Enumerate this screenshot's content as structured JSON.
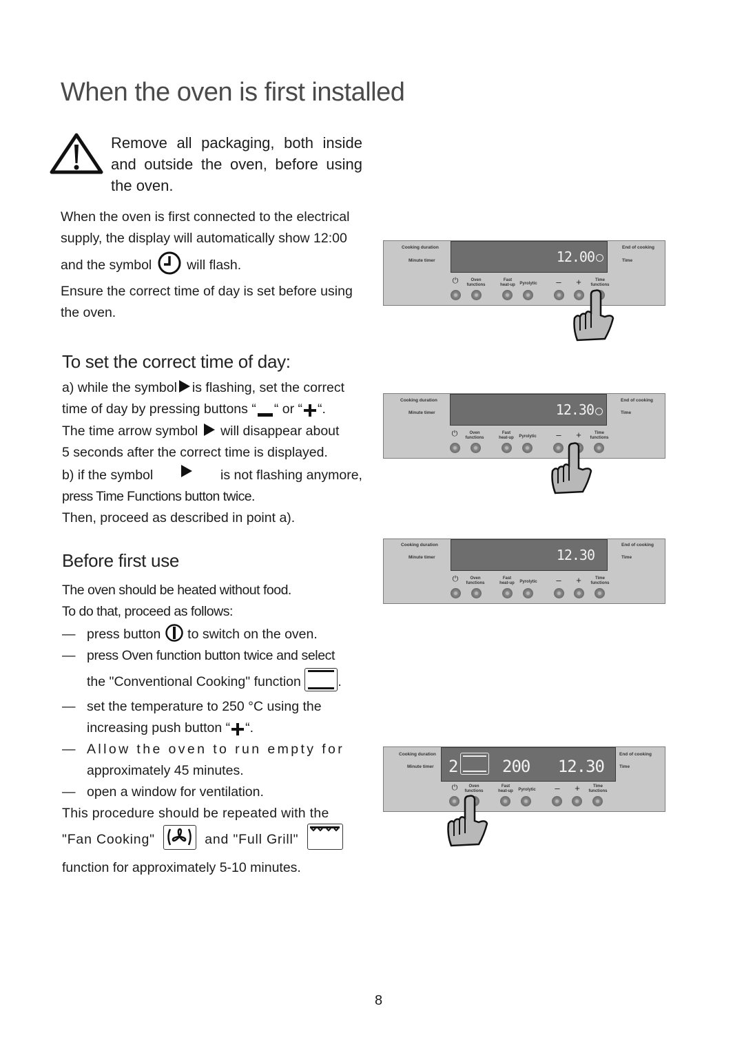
{
  "page": {
    "title": "When the oven is first installed",
    "page_number": "8"
  },
  "warning": {
    "icon": "warning-triangle-icon",
    "text": "Remove all packaging, both inside and outside the oven, before using the oven."
  },
  "intro": {
    "line1": "When the oven is first connected to the electrical",
    "line2": "supply, the display will automatically show 12:00",
    "line3_pre": "and the symbol",
    "line3_icon": "clock-icon",
    "line3_post": "will flash.",
    "line4": "Ensure the correct time of day is set before using",
    "line5": "the oven."
  },
  "set_time": {
    "heading": "To set the correct time of day:",
    "a1_pre": "a) while the symbol",
    "a1_post": "is flashing, set the correct",
    "a2_pre": "time of day by pressing buttons “",
    "a2_mid": "“ or “",
    "a2_post": "“.",
    "a3_pre": "The time arrow symbol",
    "a3_post": "will disappear about",
    "a4": "5 seconds after the correct time is displayed.",
    "b1_pre": "b) if the symbol",
    "b1_post": "is not flashing anymore,",
    "b2": "press Time Functions button twice.",
    "b3": "Then, proceed as described in point a)."
  },
  "first_use": {
    "heading": "Before first use",
    "p1": "The oven should be heated without food.",
    "p2": "To do that, proceed as follows:",
    "dash": "—",
    "s1_pre": "press button",
    "s1_post": "to switch on the oven.",
    "s2_line1": "press Oven function button twice and select",
    "s2_line2": "the \"Conventional Cooking\" function",
    "s2_end": ".",
    "s3_line1": "set the temperature to 250 °C using the",
    "s3_line2_pre": "increasing push button “",
    "s3_line2_post": "“.",
    "s4_line1": "Allow the oven to run empty for",
    "s4_line2": "approximately 45 minutes.",
    "s5": "open a window for ventilation.",
    "r1": "This procedure should be repeated with the",
    "r2_a": "\"Fan Cooking\"",
    "r2_b": "and \"Full Grill\"",
    "r3": "function for approximately 5-10 minutes."
  },
  "panel_labels": {
    "cooking_duration": "Cooking duration",
    "minute_timer": "Minute timer",
    "end_of_cooking": "End of cooking",
    "time": "Time",
    "oven_functions": "Oven\nfunctions",
    "fast_heat_up": "Fast\nheat-up",
    "pyrolytic": "Pyrolytic",
    "minus": "–",
    "plus": "+",
    "time_functions": "Time\nfunctions",
    "power": "⏻"
  },
  "panels": [
    {
      "display_time": "12.00",
      "show_clock": true,
      "pressed_button": "time-functions"
    },
    {
      "display_time": "12.30",
      "show_clock": true,
      "pressed_button": "plus"
    },
    {
      "display_time": "12.30",
      "show_clock": false,
      "pressed_button": null
    },
    {
      "display_function": "2",
      "display_temp": "200",
      "display_time": "12.30",
      "show_clock": false,
      "pressed_button": "oven-functions"
    }
  ]
}
